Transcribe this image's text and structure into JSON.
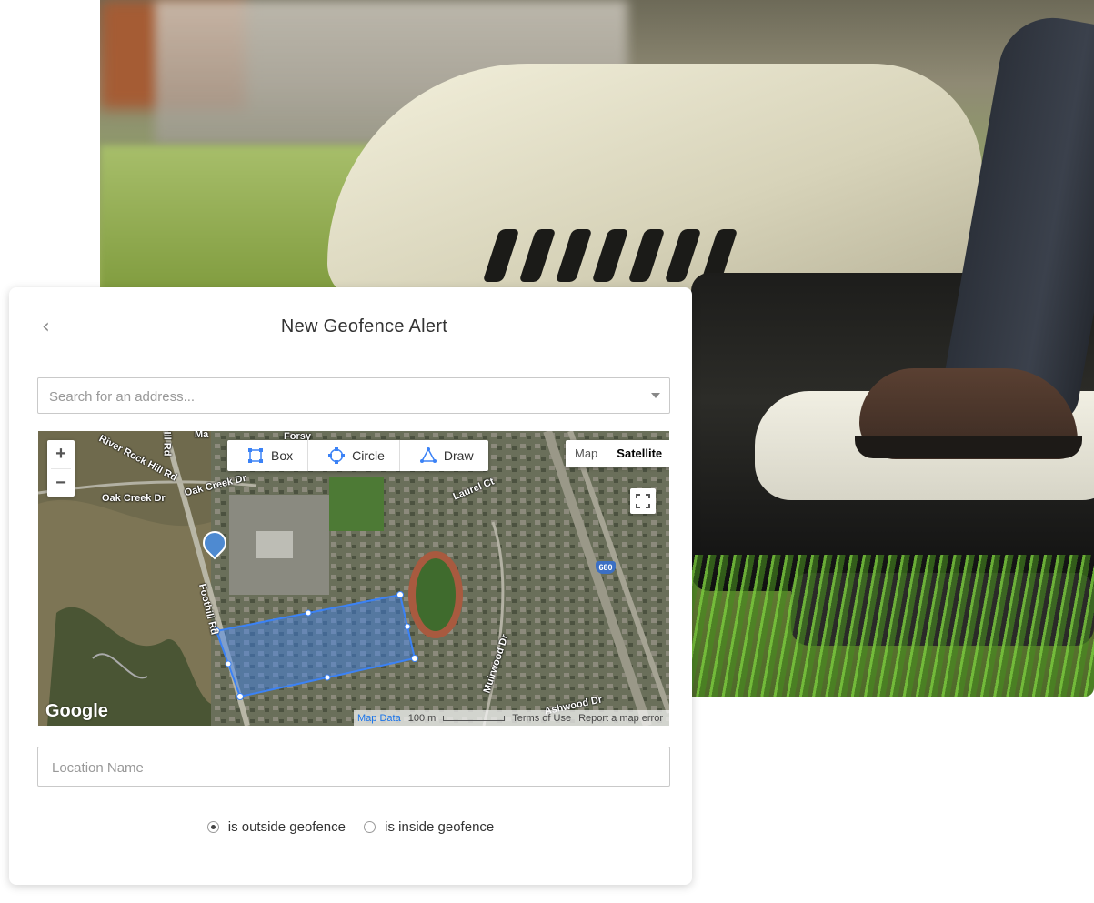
{
  "header": {
    "title": "New Geofence Alert",
    "back_label": "‹"
  },
  "search": {
    "placeholder": "Search for an address..."
  },
  "map": {
    "zoom_in": "+",
    "zoom_out": "−",
    "draw_tools": [
      {
        "label": "Box",
        "icon": "box-icon"
      },
      {
        "label": "Circle",
        "icon": "circle-icon"
      },
      {
        "label": "Draw",
        "icon": "polygon-icon"
      }
    ],
    "map_type": {
      "map": "Map",
      "satellite": "Satellite",
      "selected": "Satellite"
    },
    "road_labels": [
      "River Rock Hill Rd",
      "Oak Creek Dr",
      "Oak Creek Dr",
      "Laurel Ct",
      "Foothill Rd",
      "Muirwood Dr",
      "Ashwood Dr",
      "Forsy",
      "Ma",
      "Ill Rd"
    ],
    "highway_shield": "680",
    "logo": "Google",
    "footer": {
      "map_data": "Map Data",
      "scale": "100 m",
      "terms": "Terms of Use",
      "report": "Report a map error"
    },
    "geofence_color": "#3b82f6"
  },
  "location_name": {
    "placeholder": "Location Name"
  },
  "alert_condition": {
    "options": [
      "is outside geofence",
      "is inside geofence"
    ],
    "selected": "is outside geofence"
  }
}
